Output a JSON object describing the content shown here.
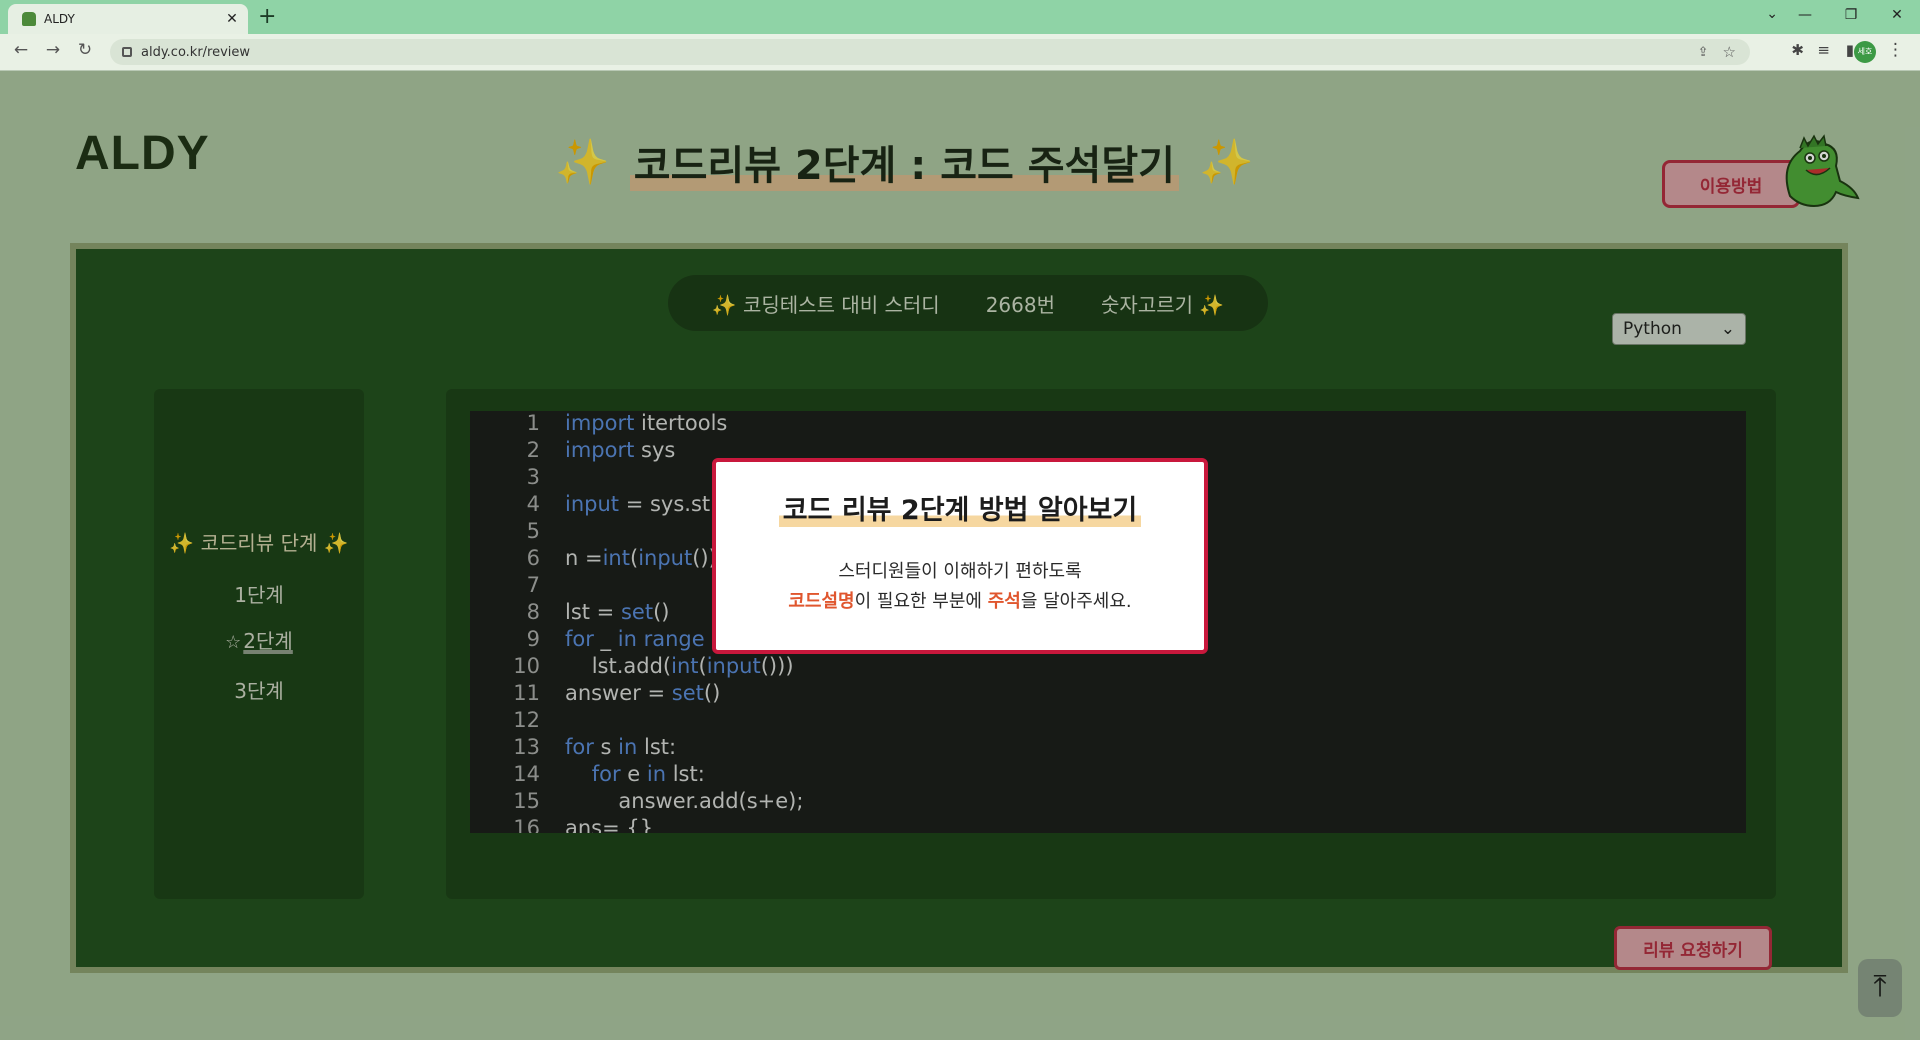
{
  "browser": {
    "tab_title": "ALDY",
    "tab_close": "✕",
    "new_tab": "+",
    "url": "aldy.co.kr/review",
    "profile": "세호"
  },
  "page": {
    "logo": "ALDY",
    "heading": "코드리뷰 2단계 : 코드 주석달기",
    "sparkle": "✨",
    "howto_button": "이용방법",
    "study_name": "코딩테스트 대비 스터디",
    "problem_number": "2668번",
    "problem_title": "숫자고르기",
    "language": "Python",
    "sidebar_title": "코드리뷰 단계",
    "steps": [
      "1단계",
      "2단계",
      "3단계"
    ],
    "request_button": "리뷰 요청하기",
    "to_top": "⤒"
  },
  "code_lines": [
    {
      "n": "1",
      "parts": [
        [
          "kw",
          "import"
        ],
        [
          "t",
          " itertools"
        ]
      ]
    },
    {
      "n": "2",
      "parts": [
        [
          "kw",
          "import"
        ],
        [
          "t",
          " sys"
        ]
      ]
    },
    {
      "n": "3",
      "parts": []
    },
    {
      "n": "4",
      "parts": [
        [
          "kw",
          "input"
        ],
        [
          "t",
          " = sys.st"
        ]
      ]
    },
    {
      "n": "5",
      "parts": []
    },
    {
      "n": "6",
      "parts": [
        [
          "t",
          "n ="
        ],
        [
          "kw",
          "int"
        ],
        [
          "t",
          "("
        ],
        [
          "kw",
          "input"
        ],
        [
          "t",
          "())"
        ]
      ]
    },
    {
      "n": "7",
      "parts": []
    },
    {
      "n": "8",
      "parts": [
        [
          "t",
          "lst = "
        ],
        [
          "kw",
          "set"
        ],
        [
          "t",
          "()"
        ]
      ]
    },
    {
      "n": "9",
      "parts": [
        [
          "kw",
          "for"
        ],
        [
          "t",
          " _ "
        ],
        [
          "kw",
          "in"
        ],
        [
          "t",
          " "
        ],
        [
          "kw",
          "range"
        ]
      ]
    },
    {
      "n": "10",
      "parts": [
        [
          "t",
          "    lst.add("
        ],
        [
          "kw",
          "int"
        ],
        [
          "t",
          "("
        ],
        [
          "kw",
          "input"
        ],
        [
          "t",
          "()))"
        ]
      ]
    },
    {
      "n": "11",
      "parts": [
        [
          "t",
          "answer = "
        ],
        [
          "kw",
          "set"
        ],
        [
          "t",
          "()"
        ]
      ]
    },
    {
      "n": "12",
      "parts": []
    },
    {
      "n": "13",
      "parts": [
        [
          "kw",
          "for"
        ],
        [
          "t",
          " s "
        ],
        [
          "kw",
          "in"
        ],
        [
          "t",
          " lst:"
        ]
      ]
    },
    {
      "n": "14",
      "parts": [
        [
          "t",
          "    "
        ],
        [
          "kw",
          "for"
        ],
        [
          "t",
          " e "
        ],
        [
          "kw",
          "in"
        ],
        [
          "t",
          " lst:"
        ]
      ]
    },
    {
      "n": "15",
      "parts": [
        [
          "t",
          "        answer.add(s+e);"
        ]
      ]
    },
    {
      "n": "16",
      "parts": [
        [
          "t",
          "ans= {}"
        ]
      ]
    }
  ],
  "modal": {
    "title": "코드 리뷰 2단계 방법 알아보기",
    "line1": "스터디원들이 이해하기 편하도록",
    "hl1": "코드설명",
    "mid": "이 필요한 부분에 ",
    "hl2": "주석",
    "end": "을 달아주세요."
  }
}
